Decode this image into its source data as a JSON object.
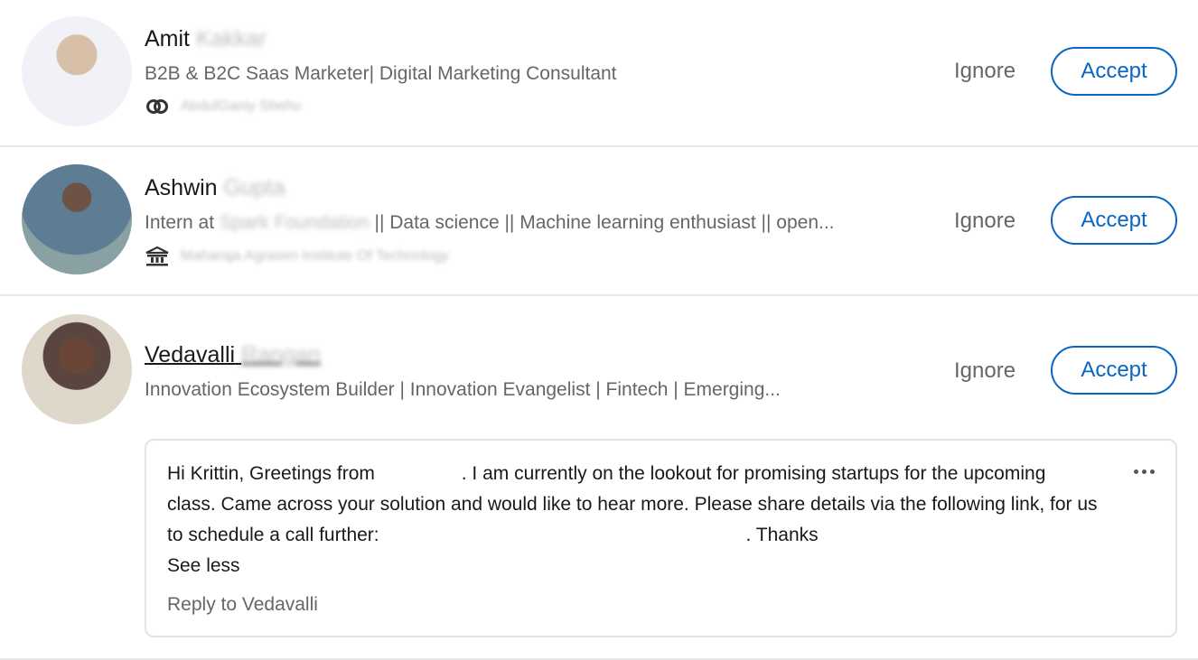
{
  "invitations": [
    {
      "first_name": "Amit",
      "last_name": "Kakkar",
      "headline": "B2B & B2C Saas Marketer| Digital Marketing Consultant",
      "meta_icon": "shared-connections-icon",
      "meta_text": "AbdulGaniy Shehu",
      "ignore_label": "Ignore",
      "accept_label": "Accept"
    },
    {
      "first_name": "Ashwin",
      "last_name": "Gupta",
      "headline_prefix": "Intern at ",
      "headline_blurred": "Spark Foundation",
      "headline_suffix": " || Data science || Machine learning enthusiast || open...",
      "meta_icon": "school-icon",
      "meta_text": "Maharaja Agrasen Institute Of Technology",
      "ignore_label": "Ignore",
      "accept_label": "Accept"
    },
    {
      "first_name": "Vedavalli",
      "last_name": "Rangan",
      "headline": "Innovation Ecosystem Builder | Innovation Evangelist | Fintech | Emerging...",
      "ignore_label": "Ignore",
      "accept_label": "Accept",
      "message": {
        "part1": "Hi Krittin, Greetings from ",
        "part2": ". I am currently on the lookout for promising startups for the upcoming class. Came across your solution and would like to hear more. Please share details via the following link, for us to schedule a call further: ",
        "part3": ". Thanks",
        "see_less": "See less",
        "reply": "Reply to Vedavalli",
        "more_icon": "more-options-icon"
      }
    }
  ]
}
